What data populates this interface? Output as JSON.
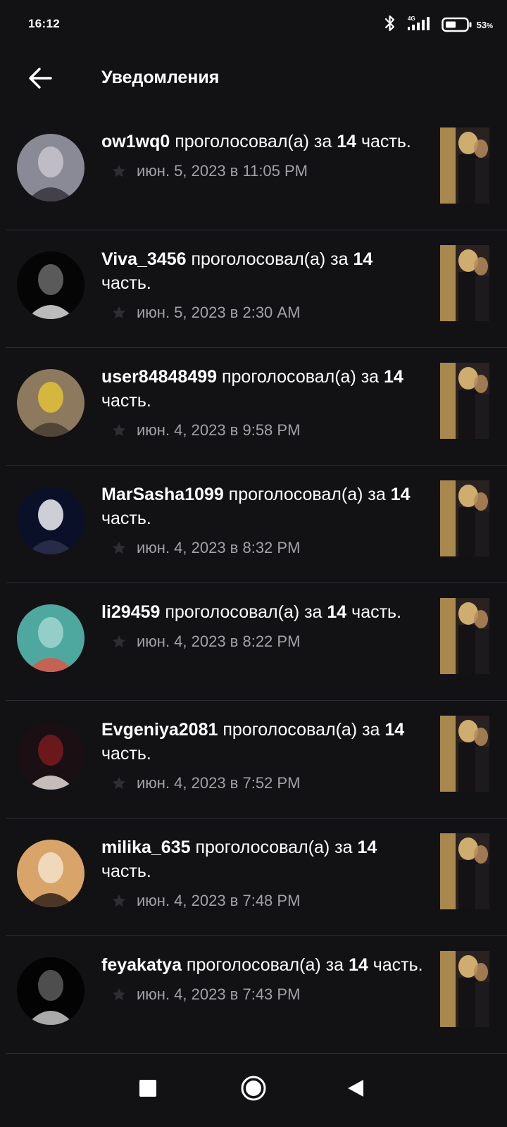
{
  "status_bar": {
    "time": "16:12",
    "network": "4G",
    "battery": "53",
    "battery_unit": "%",
    "battery_level": 0.53,
    "icons": [
      "bluetooth-icon",
      "signal-icon",
      "battery-icon"
    ]
  },
  "app_bar": {
    "back_icon": "arrow-left-icon",
    "title": "Уведомления"
  },
  "notifications": [
    {
      "user": "ow1wq0",
      "action": " проголосовал(а) за ",
      "count": "14",
      "suffix": " часть.",
      "time": "июн. 5, 2023 в 11:05 PM"
    },
    {
      "user": "Viva_3456",
      "action": " проголосовал(а) за ",
      "count": "14",
      "suffix": " часть.",
      "time": "июн. 5, 2023 в 2:30 AM"
    },
    {
      "user": "user84848499",
      "action": " проголосовал(а) за ",
      "count": "14",
      "suffix": " часть.",
      "time": "июн. 4, 2023 в 9:58 PM"
    },
    {
      "user": "MarSasha1099",
      "action": " проголосовал(а) за ",
      "count": "14",
      "suffix": " часть.",
      "time": "июн. 4, 2023 в 8:32 PM"
    },
    {
      "user": "li29459",
      "action": " проголосовал(а) за ",
      "count": "14",
      "suffix": " часть.",
      "time": "июн. 4, 2023 в 8:22 PM"
    },
    {
      "user": "Evgeniya2081",
      "action": " проголосовал(а) за ",
      "count": "14",
      "suffix": " часть.",
      "time": "июн. 4, 2023 в 7:52 PM"
    },
    {
      "user": "milika_635",
      "action": " проголосовал(а) за ",
      "count": "14",
      "suffix": " часть.",
      "time": "июн. 4, 2023 в 7:48 PM"
    },
    {
      "user": "feyakatya",
      "action": " проголосовал(а) за ",
      "count": "14",
      "suffix": " часть.",
      "time": "июн. 4, 2023 в 7:43 PM"
    }
  ],
  "nav_bar": {
    "icons": [
      "recents-square-icon",
      "home-circle-icon",
      "back-triangle-icon"
    ]
  },
  "colors": {
    "background": "#121114",
    "text_primary": "#ffffff",
    "text_secondary": "#a3a1a7",
    "divider": "#2c2b30",
    "star": "#2f2e33"
  }
}
